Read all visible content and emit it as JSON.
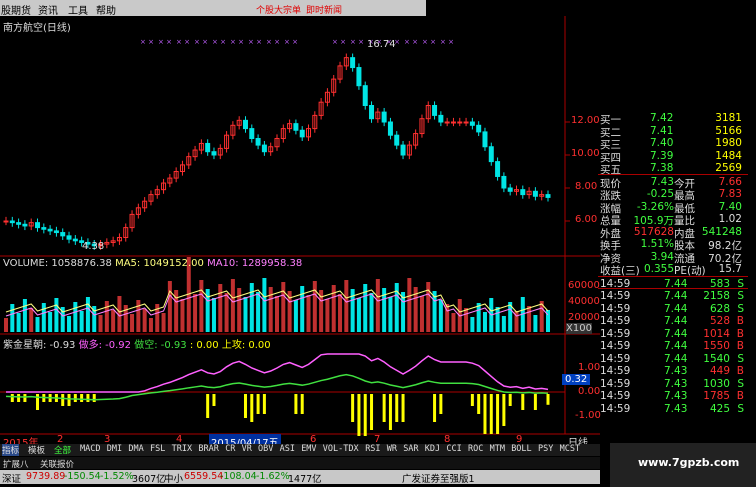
{
  "menu": {
    "items": [
      "股期货",
      "资讯",
      "工具",
      "帮助"
    ],
    "red_center": "个股大宗单",
    "red_right": "即时新闻"
  },
  "stock": {
    "title": "南方航空(日线)",
    "high_marker": "16.74",
    "low_marker": "4.38"
  },
  "price_axis": [
    "12.00",
    "10.00",
    "8.00",
    "6.00"
  ],
  "volume": {
    "label": "VOLUME: 1058876.38",
    "ma5": "MA5: 1049152.00",
    "ma10": "MA10: 1289958.38",
    "axis": [
      "60000",
      "40000",
      "20000"
    ],
    "unit": "X100"
  },
  "indicator": {
    "name": "紫金星朝",
    "v1": ": -0.93",
    "duoduo": "做多: -0.92",
    "zuokong": "做空: -0.93",
    "v4": ": 0.00",
    "v5": "上攻: 0.00",
    "axis": [
      "1.00",
      "0.00",
      "-1.00"
    ],
    "cursor_value": "0.32"
  },
  "dates": {
    "start": "2015年",
    "m2": "2",
    "m3": "3",
    "m4": "4",
    "cursor": "2015/04/17五",
    "m6": "6",
    "m7": "7",
    "m8": "8",
    "m9": "9",
    "period": "日线"
  },
  "bottom_tabs": [
    "指标",
    "模板",
    "全部",
    "MACD",
    "DMI",
    "DMA",
    "FSL",
    "TRIX",
    "BRAR",
    "CR",
    "VR",
    "OBV",
    "ASI",
    "EMV",
    "VOL-TDX",
    "RSI",
    "WR",
    "SAR",
    "KDJ",
    "CCI",
    "ROC",
    "MTM",
    "BOLL",
    "PSY",
    "MCST"
  ],
  "sub_tabs": [
    "扩展八",
    "关联报价"
  ],
  "orderbook": [
    {
      "label": "买一",
      "price": "7.42",
      "vol": "3181"
    },
    {
      "label": "买二",
      "price": "7.41",
      "vol": "5166"
    },
    {
      "label": "买三",
      "price": "7.40",
      "vol": "1980"
    },
    {
      "label": "买四",
      "price": "7.39",
      "vol": "1484"
    },
    {
      "label": "买五",
      "price": "7.38",
      "vol": "2569"
    }
  ],
  "stats": [
    {
      "l1": "现价",
      "v1": "7.43",
      "l2": "今开",
      "v2": "7.66"
    },
    {
      "l1": "涨跌",
      "v1": "-0.25",
      "l2": "最高",
      "v2": "7.83"
    },
    {
      "l1": "涨幅",
      "v1": "-3.26%",
      "l2": "最低",
      "v2": "7.40"
    },
    {
      "l1": "总量",
      "v1": "105.9万",
      "l2": "量比",
      "v2": "1.02"
    },
    {
      "l1": "外盘",
      "v1": "517628",
      "l2": "内盘",
      "v2": "541248"
    },
    {
      "l1": "换手",
      "v1": "1.51%",
      "l2": "股本",
      "v2": "98.2亿"
    },
    {
      "l1": "净资",
      "v1": "3.94",
      "l2": "流通",
      "v2": "70.2亿"
    },
    {
      "l1": "收益(三)",
      "v1": "0.355",
      "l2": "PE(动)",
      "v2": "15.7"
    }
  ],
  "ticks": [
    {
      "t": "14:59",
      "p": "7.44",
      "v": "583",
      "d": "S"
    },
    {
      "t": "14:59",
      "p": "7.44",
      "v": "2158",
      "d": "S"
    },
    {
      "t": "14:59",
      "p": "7.44",
      "v": "628",
      "d": "S"
    },
    {
      "t": "14:59",
      "p": "7.44",
      "v": "528",
      "d": "B"
    },
    {
      "t": "14:59",
      "p": "7.44",
      "v": "1014",
      "d": "B"
    },
    {
      "t": "14:59",
      "p": "7.44",
      "v": "1550",
      "d": "B"
    },
    {
      "t": "14:59",
      "p": "7.44",
      "v": "1540",
      "d": "S"
    },
    {
      "t": "14:59",
      "p": "7.43",
      "v": "449",
      "d": "B"
    },
    {
      "t": "14:59",
      "p": "7.43",
      "v": "1030",
      "d": "S"
    },
    {
      "t": "14:59",
      "p": "7.43",
      "v": "1785",
      "d": "B"
    },
    {
      "t": "14:59",
      "p": "7.43",
      "v": "425",
      "d": "S"
    }
  ],
  "status": {
    "sh": "深证",
    "shval": "9739.89",
    "shchg": "-150.54",
    "shpct": "-1.52%",
    "shamt": "3607亿",
    "zx": "中小",
    "zxval": "6559.54",
    "zxchg": "-108.04",
    "zxpct": "-1.62%",
    "zxamt": "1477亿",
    "broker": "广发证券至强版1"
  },
  "watermark": "www.7gpzb.com",
  "colors": {
    "up": "#ff3030",
    "down": "#00e5e5",
    "yellow": "#ffff00",
    "magenta": "#ff60ff",
    "green": "#40e040"
  }
}
